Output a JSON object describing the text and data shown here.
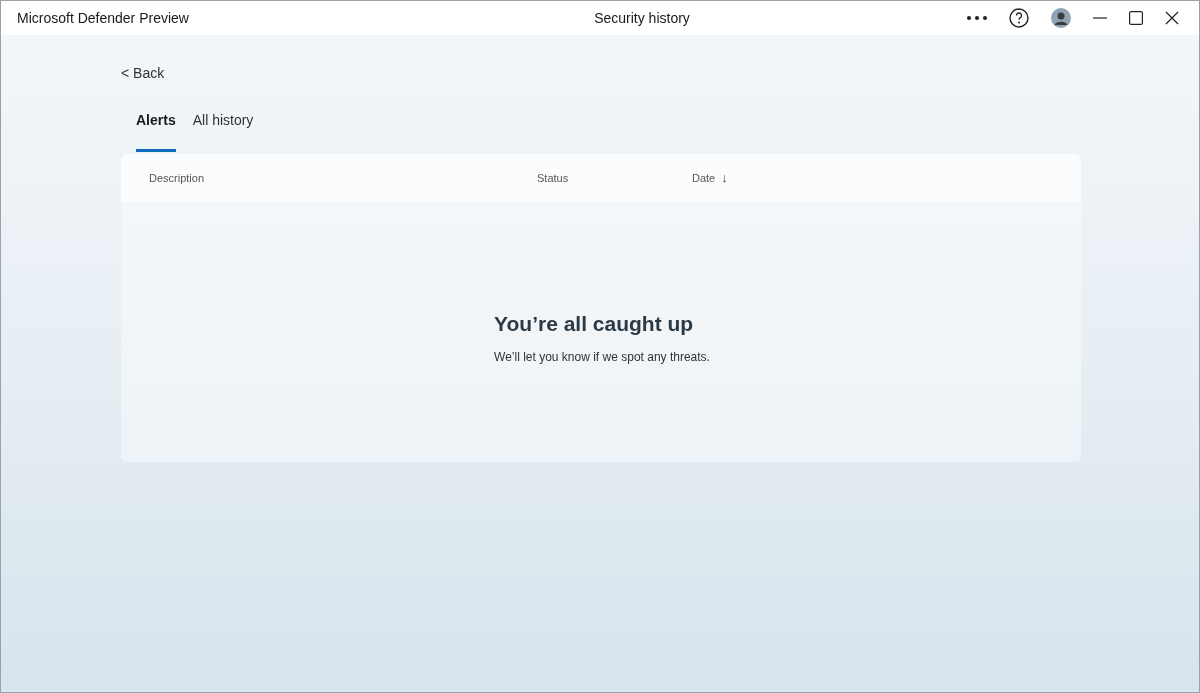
{
  "window": {
    "app_name": "Microsoft Defender Preview",
    "title": "Security history"
  },
  "back": {
    "label": "< Back"
  },
  "tabs": [
    {
      "label": "Alerts",
      "selected": true
    },
    {
      "label": "All history",
      "selected": false
    }
  ],
  "table": {
    "columns": [
      {
        "label": "Description"
      },
      {
        "label": "Status"
      },
      {
        "label": "Date",
        "sort_indicator": "↓"
      }
    ]
  },
  "empty_state": {
    "title": "You’re all caught up",
    "message": "We’ll let you know if we spot any threats."
  }
}
